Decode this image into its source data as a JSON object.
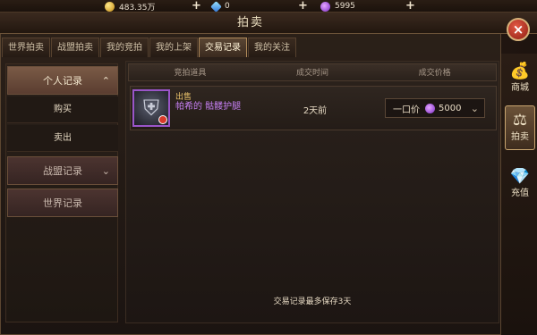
{
  "currencies": {
    "gold": "483.35万",
    "diamond": "0",
    "amethyst": "5995"
  },
  "window": {
    "title": "拍卖",
    "close_icon": "×"
  },
  "tabs": [
    {
      "label": "世界拍卖"
    },
    {
      "label": "战盟拍卖"
    },
    {
      "label": "我的竞拍"
    },
    {
      "label": "我的上架"
    },
    {
      "label": "交易记录"
    },
    {
      "label": "我的关注"
    }
  ],
  "left_panel": {
    "personal": "个人记录",
    "buy": "购买",
    "sell": "卖出",
    "guild": "战盟记录",
    "world": "世界记录"
  },
  "table": {
    "headers": [
      "竞拍道具",
      "成交时间",
      "成交价格"
    ],
    "records": [
      {
        "tag": "出售",
        "item_name": "帕希的 骷髅护腿",
        "time": "2天前",
        "price_label": "一口价",
        "price": "5000"
      }
    ]
  },
  "note": "交易记录最多保存3天",
  "side_menu": [
    {
      "label": "商城"
    },
    {
      "label": "拍卖"
    },
    {
      "label": "充值"
    }
  ],
  "colors": {
    "accent_purple": "#c57ff2",
    "gold": "#e8c06a"
  }
}
